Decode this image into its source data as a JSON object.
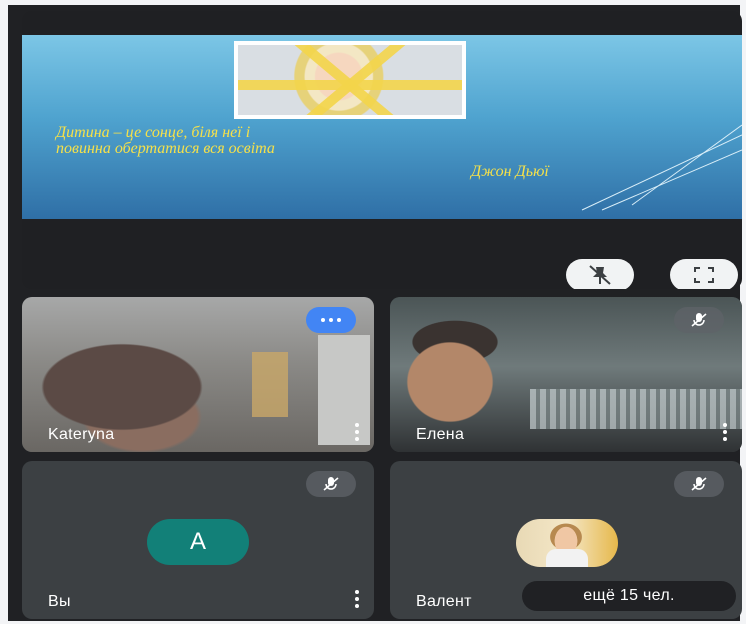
{
  "presentation": {
    "quote_line1": "Дитина – це сонце, біля неї і",
    "quote_line2": "повинна обертатися вся освіта",
    "author": "Джон Дьюї",
    "buttons": {
      "pin_icon": "pin-off-icon",
      "fullscreen_icon": "fullscreen-icon"
    }
  },
  "participants": [
    {
      "name": "Kateryna",
      "badge": "more-options",
      "badge_color": "#4285f4"
    },
    {
      "name": "Елена",
      "badge": "mic-off"
    },
    {
      "name": "Вы",
      "badge": "mic-off",
      "avatar_letter": "A",
      "avatar_color": "#128078"
    },
    {
      "name": "Валент",
      "badge": "mic-off",
      "avatar": "photo"
    }
  ],
  "more_participants_label": "ещё 15 чел.",
  "colors": {
    "background": "#202124",
    "tile": "#3c4043",
    "accent": "#4285f4",
    "quote": "#f5e14a"
  }
}
